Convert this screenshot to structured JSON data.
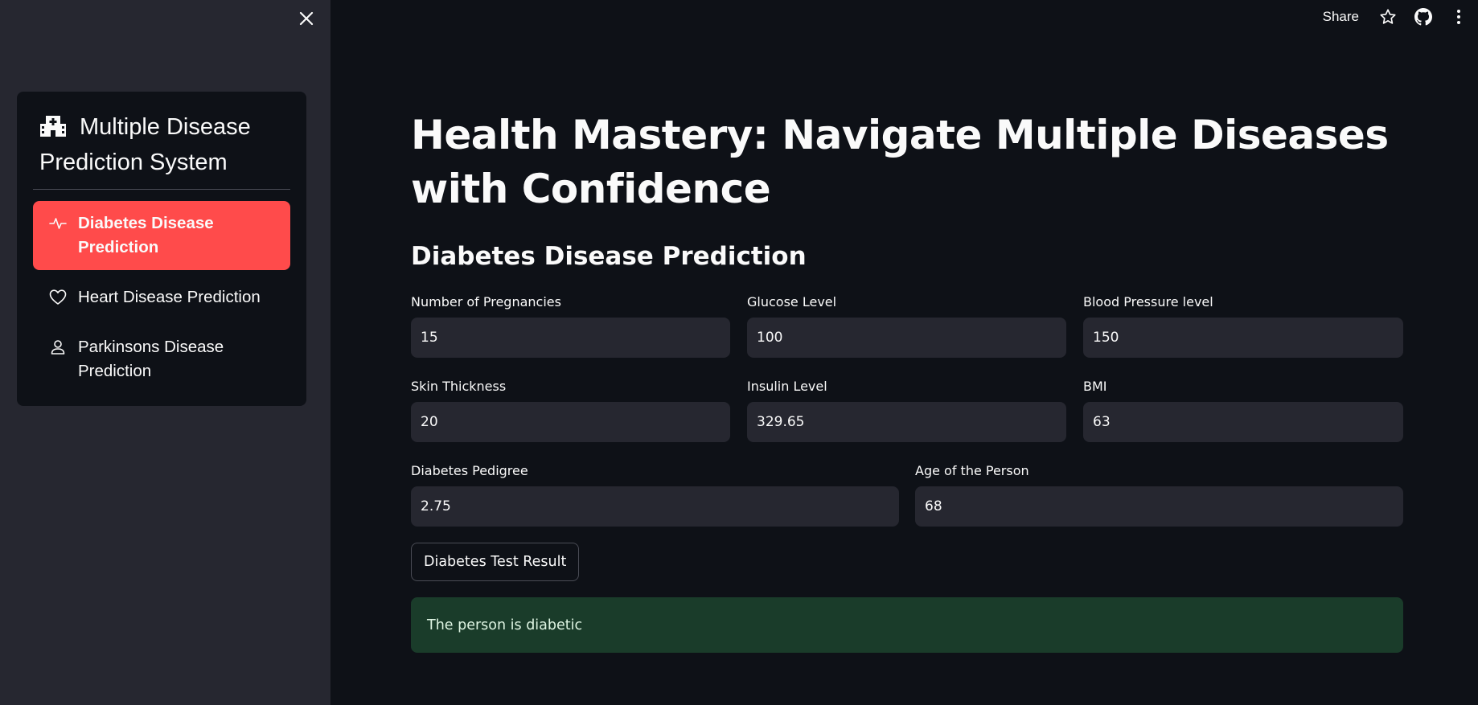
{
  "sidebar": {
    "close_icon": "close-icon",
    "menu": {
      "title": "Multiple Disease Prediction System",
      "title_icon": "hospital-icon",
      "active_color": "#ff4b4b",
      "items": [
        {
          "label": "Diabetes Disease Prediction",
          "icon": "activity-icon",
          "active": true
        },
        {
          "label": "Heart Disease Prediction",
          "icon": "heart-icon",
          "active": false
        },
        {
          "label": "Parkinsons Disease Prediction",
          "icon": "person-icon",
          "active": false
        }
      ]
    }
  },
  "toolbar": {
    "share_label": "Share",
    "icons": [
      "star-icon",
      "github-icon",
      "more-vertical-icon"
    ]
  },
  "main": {
    "title": "Health Mastery: Navigate Multiple Diseases with Confidence",
    "section_title": "Diabetes Disease Prediction",
    "fields": [
      {
        "label": "Number of Pregnancies",
        "value": "15"
      },
      {
        "label": "Glucose Level",
        "value": "100"
      },
      {
        "label": "Blood Pressure level",
        "value": "150"
      },
      {
        "label": "Skin Thickness",
        "value": "20"
      },
      {
        "label": "Insulin Level",
        "value": "329.65"
      },
      {
        "label": "BMI",
        "value": "63"
      },
      {
        "label": "Diabetes Pedigree",
        "value": "2.75"
      },
      {
        "label": "Age of the Person",
        "value": "68"
      }
    ],
    "button_label": "Diabetes Test Result",
    "result_text": "The person is diabetic",
    "result_color": "#1a3c2a"
  }
}
